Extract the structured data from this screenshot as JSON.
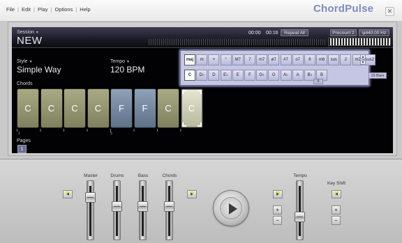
{
  "menu": [
    "File",
    "Edit",
    "Play",
    "Options",
    "Help"
  ],
  "app_title": "ChordPulse",
  "close_glyph": "✕",
  "session": {
    "label": "Session",
    "name": "NEW"
  },
  "transport": {
    "time_current": "00:00",
    "time_total": "00:16",
    "repeat_label": "Repeat All",
    "precount_label": "Precount 2",
    "tuning_label": "440.00 Hz"
  },
  "style": {
    "label": "Style",
    "value": "Simple Way"
  },
  "tempo": {
    "label": "Tempo",
    "value": "120 BPM"
  },
  "chords_label": "Chords",
  "chords": [
    {
      "name": "C",
      "color": "olive"
    },
    {
      "name": "C",
      "color": "olive"
    },
    {
      "name": "C",
      "color": "olive"
    },
    {
      "name": "C",
      "color": "olive"
    },
    {
      "name": "F",
      "color": "blue"
    },
    {
      "name": "F",
      "color": "blue"
    },
    {
      "name": "C",
      "color": "olive"
    },
    {
      "name": "C",
      "color": "pale",
      "selected": true
    }
  ],
  "beat_markers": [
    "1",
    "5"
  ],
  "pages": {
    "label": "Pages",
    "items": [
      "1"
    ]
  },
  "picker": {
    "qualities": [
      "maj",
      "m",
      "+",
      "°",
      "M7",
      "7",
      "m7",
      "ø7",
      "#7",
      "o7",
      "6",
      "m6",
      "sus",
      "2",
      "m2",
      "sus2"
    ],
    "selected_quality": "maj",
    "roots": [
      "C",
      "D♭",
      "D",
      "E♭",
      "E",
      "F",
      "G♭",
      "G",
      "A♭",
      "A",
      "B♭",
      "B"
    ],
    "selected_root": "C",
    "badge": "9",
    "bars_label": "16 Bars"
  },
  "mixer": {
    "master_label": "Master",
    "drums_label": "Drums",
    "bass_label": "Bass",
    "chords_label": "Chords",
    "tempo_label": "Tempo",
    "keyshift_label": "Key Shift",
    "plus_glyph": "+",
    "minus_glyph": "−",
    "levels": {
      "master": 0.82,
      "drums": 0.62,
      "bass": 0.62,
      "chords": 0.62,
      "tempo": 0.4
    }
  }
}
